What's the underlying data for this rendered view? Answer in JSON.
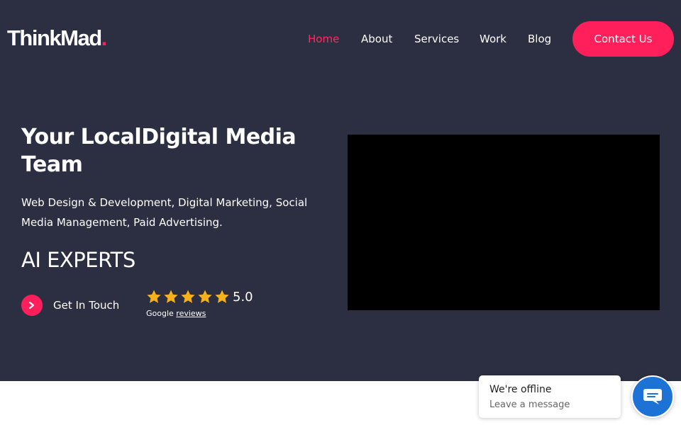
{
  "header": {
    "logo_text": "ThinkMad",
    "logo_dot": ".",
    "nav": [
      {
        "label": "Home",
        "active": true
      },
      {
        "label": "About",
        "active": false
      },
      {
        "label": "Services",
        "active": false
      },
      {
        "label": "Work",
        "active": false
      },
      {
        "label": "Blog",
        "active": false
      }
    ],
    "contact_label": "Contact Us"
  },
  "hero": {
    "headline": "Your LocalDigital Media Team",
    "subline": "Web Design & Development, Digital Marketing, Social Media Management, Paid Advertising.",
    "tagline": "AI EXPERTS",
    "cta_label": "Get In Touch",
    "cta_icon": "chevron-right-icon",
    "rating": {
      "stars": 5,
      "value": "5.0",
      "source": "Google",
      "reviews_link": "reviews"
    }
  },
  "chat": {
    "status": "We're offline",
    "prompt": "Leave a message",
    "icon": "chat-icon"
  },
  "colors": {
    "hero_bg": "#2c2f42",
    "accent": "#ff1f5a",
    "nav_active": "#ff2a5f",
    "star": "#f7b21b",
    "chat_blue": "#1d73d5"
  }
}
